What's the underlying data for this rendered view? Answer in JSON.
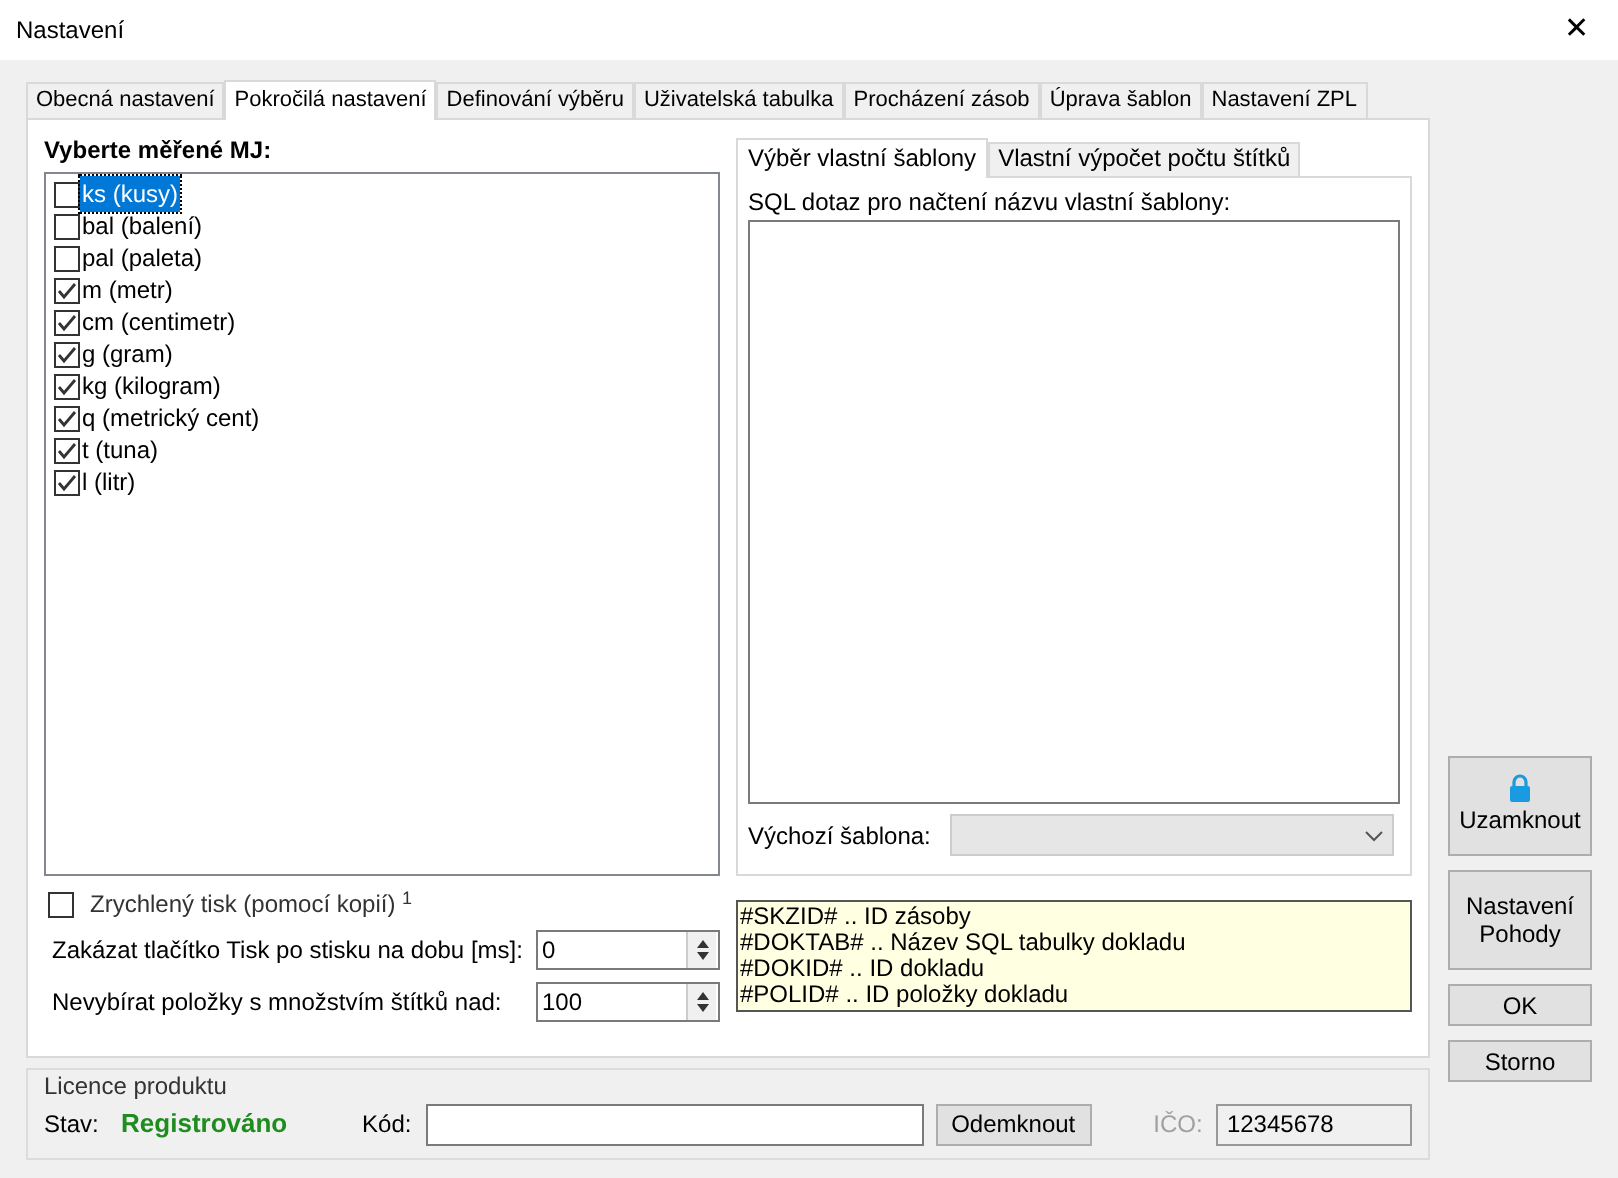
{
  "window": {
    "title": "Nastavení",
    "close": "✕"
  },
  "tabs": [
    {
      "label": "Obecná nastavení",
      "selected": false
    },
    {
      "label": "Pokročilá nastavení",
      "selected": true
    },
    {
      "label": "Definování výběru",
      "selected": false
    },
    {
      "label": "Uživatelská tabulka",
      "selected": false
    },
    {
      "label": "Procházení zásob",
      "selected": false
    },
    {
      "label": "Úprava šablon",
      "selected": false
    },
    {
      "label": "Nastavení ZPL",
      "selected": false
    }
  ],
  "units": {
    "heading": "Vyberte měřené MJ:",
    "items": [
      {
        "label": "ks (kusy)",
        "checked": false,
        "selected": true
      },
      {
        "label": "bal (balení)",
        "checked": false,
        "selected": false
      },
      {
        "label": "pal (paleta)",
        "checked": false,
        "selected": false
      },
      {
        "label": "m (metr)",
        "checked": true,
        "selected": false
      },
      {
        "label": "cm (centimetr)",
        "checked": true,
        "selected": false
      },
      {
        "label": "g (gram)",
        "checked": true,
        "selected": false
      },
      {
        "label": "kg (kilogram)",
        "checked": true,
        "selected": false
      },
      {
        "label": "q (metrický cent)",
        "checked": true,
        "selected": false
      },
      {
        "label": "t (tuna)",
        "checked": true,
        "selected": false
      },
      {
        "label": "l (litr)",
        "checked": true,
        "selected": false
      }
    ]
  },
  "subtabs": [
    {
      "label": "Výběr vlastní šablony",
      "selected": true
    },
    {
      "label": "Vlastní výpočet počtu štítků",
      "selected": false
    }
  ],
  "sql": {
    "label": "SQL dotaz pro načtení názvu vlastní šablony:"
  },
  "default_template": {
    "label": "Výchozí šablona:",
    "disabled": true
  },
  "fast_print": {
    "label": "Zrychlený tisk (pomocí kopií) $^{1}$",
    "checked": false
  },
  "spinners": [
    {
      "label": "Zakázat tlačítko Tisk po stisku na dobu [ms]:",
      "value": "0"
    },
    {
      "label": "Nevybírat položky s množstvím štítků nad:",
      "value": "100"
    }
  ],
  "hints": [
    "#SKZID# .. ID zásoby",
    "#DOKTAB# .. Název SQL tabulky dokladu",
    "#DOKID# .. ID dokladu",
    "#POLID# .. ID položky dokladu"
  ],
  "license": {
    "title": "Licence produktu",
    "state_label": "Stav:",
    "state": "Registrováno",
    "code_label": "Kód:",
    "unlock": "Odemknout",
    "ico_label": "IČO:",
    "ico": "12345678",
    "ico_disabled": true
  },
  "side_buttons": [
    {
      "kind": "lock",
      "label": "Uzamknout"
    },
    {
      "kind": "text",
      "label": "Nastavení Pohody"
    },
    {
      "kind": "text",
      "label": "OK"
    },
    {
      "kind": "text",
      "label": "Storno"
    }
  ]
}
